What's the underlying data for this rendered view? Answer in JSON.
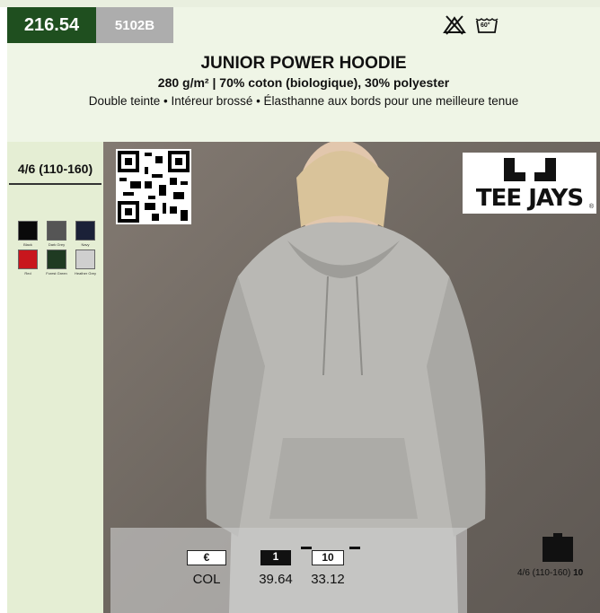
{
  "header": {
    "code_main": "216.54",
    "code_sub": "5102B",
    "wash_temp": "60°",
    "care_icons": [
      "no-bleach-icon",
      "wash-60-icon"
    ],
    "colors": {
      "code_main_bg": "#1f4f1f",
      "code_sub_bg": "#adadad"
    }
  },
  "product": {
    "title": "JUNIOR POWER HOODIE",
    "subtitle": "280 g/m² | 70% coton (biologique), 30% polyester",
    "features": "Double teinte • Intéreur brossé • Élasthanne aux bords pour une meilleure tenue"
  },
  "sidebar": {
    "size_range": "4/6 (110-160)",
    "colors": [
      {
        "name": "Black",
        "hex": "#0a0a0a"
      },
      {
        "name": "Dark Grey",
        "hex": "#555555"
      },
      {
        "name": "Navy",
        "hex": "#1b2138"
      },
      {
        "name": "Red",
        "hex": "#c8161d"
      },
      {
        "name": "Forest Green",
        "hex": "#1f3a22"
      },
      {
        "name": "Heather Grey",
        "hex": "#cfcfcf"
      }
    ]
  },
  "photo": {
    "brand": "TEE JAYS",
    "registered": "®"
  },
  "pricing": {
    "currency_header": "€",
    "qty_headers": [
      "1",
      "10"
    ],
    "row_label": "COL",
    "prices": [
      "39.64",
      "33.12"
    ]
  },
  "packaging": {
    "label": "4/6 (110-160)",
    "qty": "10"
  }
}
